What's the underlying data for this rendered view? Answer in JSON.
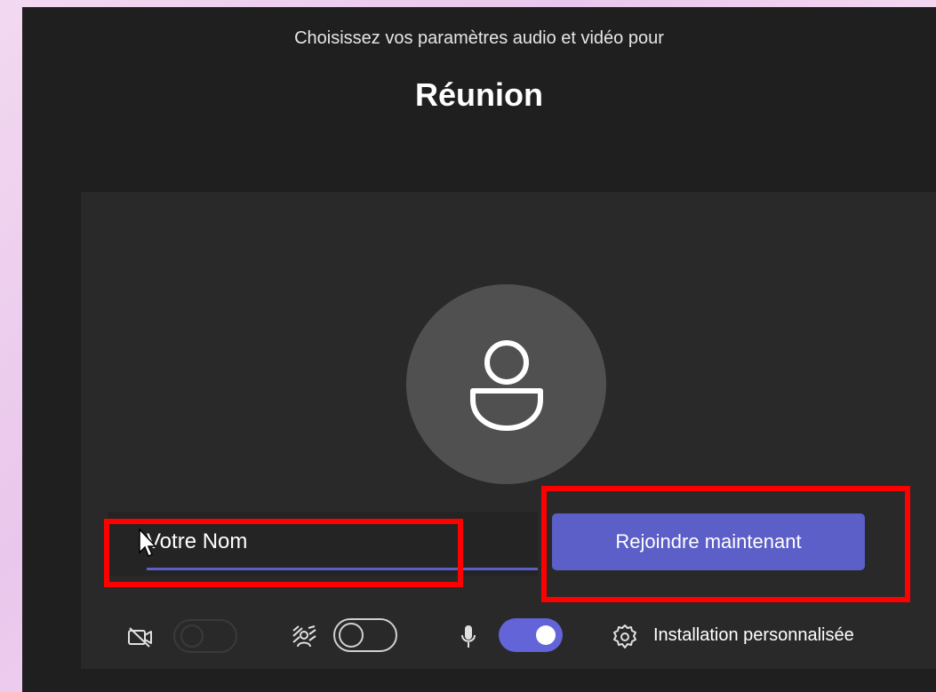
{
  "header": {
    "subtitle": "Choisissez vos paramètres audio et vidéo pour",
    "meeting_title": "Réunion"
  },
  "preview": {
    "avatar_icon": "person-icon",
    "name_input": {
      "value": "Votre Nom",
      "placeholder": "Votre Nom"
    },
    "join_button_label": "Rejoindre maintenant"
  },
  "controls": {
    "camera": {
      "icon": "camera-off-icon",
      "enabled": false
    },
    "background_effects": {
      "icon": "background-blur-icon",
      "enabled": false
    },
    "microphone": {
      "icon": "microphone-icon",
      "enabled": true
    },
    "settings": {
      "icon": "gear-icon",
      "label": "Installation personnalisée"
    }
  },
  "colors": {
    "accent": "#5b5fc7",
    "window_background": "#1f1f1f",
    "panel_background": "#292929",
    "annotation": "#ff0000"
  }
}
